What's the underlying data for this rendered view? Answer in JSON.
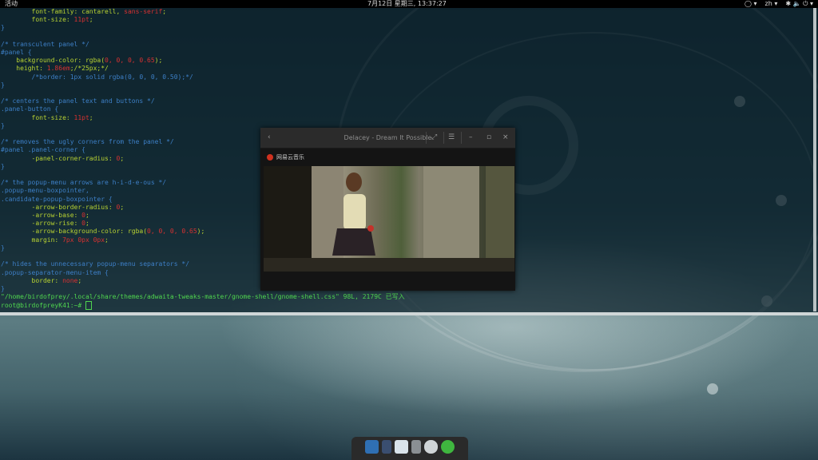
{
  "topbar": {
    "activities": "活动",
    "clock": "7月12日 星期三, 13:37:27",
    "lang": "zh ▾",
    "tray_a": "◯ ▾",
    "tray_b": "✱  🔈  ⏻ ▾"
  },
  "terminal": {
    "lines": [
      {
        "indent": "        ",
        "prop": "font-family",
        "val": " cantarell, sans-serif",
        "end": ";"
      },
      {
        "indent": "        ",
        "prop": "font-size",
        "val": " 11pt",
        "end": ";"
      }
    ],
    "status_line": "\"/home/birdofprey/.local/share/themes/adwaita-tweaks-master/gnome-shell/gnome-shell.css\" 98L, 2179C 已写入",
    "prompt": "root@birdofpreyK41:~# "
  },
  "player": {
    "title": "Delacey - Dream It Possible",
    "now_playing": "网易云音乐"
  },
  "dock": {
    "items": [
      "anchor-icon",
      "app-icon",
      "document-icon",
      "trash-icon",
      "cloud-icon",
      "green-app-icon"
    ]
  },
  "colors": {
    "terminal_bg": "#0a1e28",
    "comment": "#3d7fc6",
    "property": "#b8d232",
    "value": "#d63131",
    "prompt": "#4fd54f"
  }
}
